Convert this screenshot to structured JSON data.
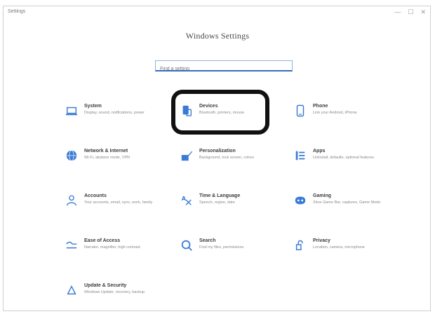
{
  "window": {
    "app_name": "Settings",
    "controls": [
      "—",
      "☐",
      "✕"
    ]
  },
  "heading": "Windows Settings",
  "search": {
    "placeholder": "Find a setting",
    "value": ""
  },
  "categories": [
    {
      "id": "system",
      "title": "System",
      "desc": "Display, sound, notifications, power",
      "icon": "laptop-icon"
    },
    {
      "id": "devices",
      "title": "Devices",
      "desc": "Bluetooth, printers, mouse",
      "icon": "devices-icon"
    },
    {
      "id": "phone",
      "title": "Phone",
      "desc": "Link your Android, iPhone",
      "icon": "phone-icon"
    },
    {
      "id": "network",
      "title": "Network & Internet",
      "desc": "Wi-Fi, airplane mode, VPN",
      "icon": "globe-icon"
    },
    {
      "id": "personalization",
      "title": "Personalization",
      "desc": "Background, lock screen, colors",
      "icon": "paintbrush-icon"
    },
    {
      "id": "apps",
      "title": "Apps",
      "desc": "Uninstall, defaults, optional features",
      "icon": "apps-icon"
    },
    {
      "id": "accounts",
      "title": "Accounts",
      "desc": "Your accounts, email, sync, work, family",
      "icon": "person-icon"
    },
    {
      "id": "time-language",
      "title": "Time & Language",
      "desc": "Speech, region, date",
      "icon": "time-language-icon"
    },
    {
      "id": "gaming",
      "title": "Gaming",
      "desc": "Xbox Game Bar, captures, Game Mode",
      "icon": "gamepad-icon"
    },
    {
      "id": "ease-of-access",
      "title": "Ease of Access",
      "desc": "Narrator, magnifier, high contrast",
      "icon": "accessibility-icon"
    },
    {
      "id": "search",
      "title": "Search",
      "desc": "Find my files, permissions",
      "icon": "search-icon"
    },
    {
      "id": "privacy",
      "title": "Privacy",
      "desc": "Location, camera, microphone",
      "icon": "lock-icon"
    },
    {
      "id": "update-security",
      "title": "Update & Security",
      "desc": "Windows Update, recovery, backup",
      "icon": "sync-icon"
    }
  ],
  "colors": {
    "accent": "#2f6fc2",
    "icon": "#3a7bd5",
    "highlight": "#111111"
  }
}
